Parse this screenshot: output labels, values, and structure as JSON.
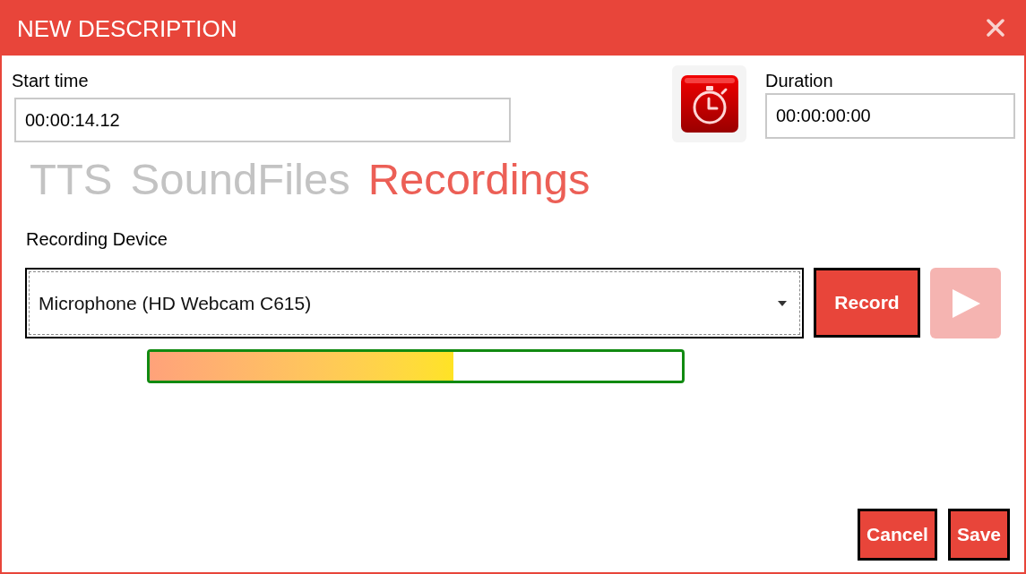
{
  "window": {
    "title": "NEW DESCRIPTION"
  },
  "start_time": {
    "label": "Start time",
    "value": "00:00:14.12"
  },
  "duration": {
    "label": "Duration",
    "value": "00:00:00:00"
  },
  "tabs": [
    {
      "label": "TTS",
      "selected": false
    },
    {
      "label": "SoundFiles",
      "selected": false
    },
    {
      "label": "Recordings",
      "selected": true
    }
  ],
  "recording_device": {
    "label": "Recording Device",
    "value": "Microphone (HD Webcam C615)"
  },
  "record_button": {
    "label": "Record"
  },
  "play_button": {
    "disabled": true
  },
  "level_meter": {
    "level": 0.57
  },
  "buttons": [
    {
      "label": "Cancel"
    },
    {
      "label": "Save"
    }
  ]
}
